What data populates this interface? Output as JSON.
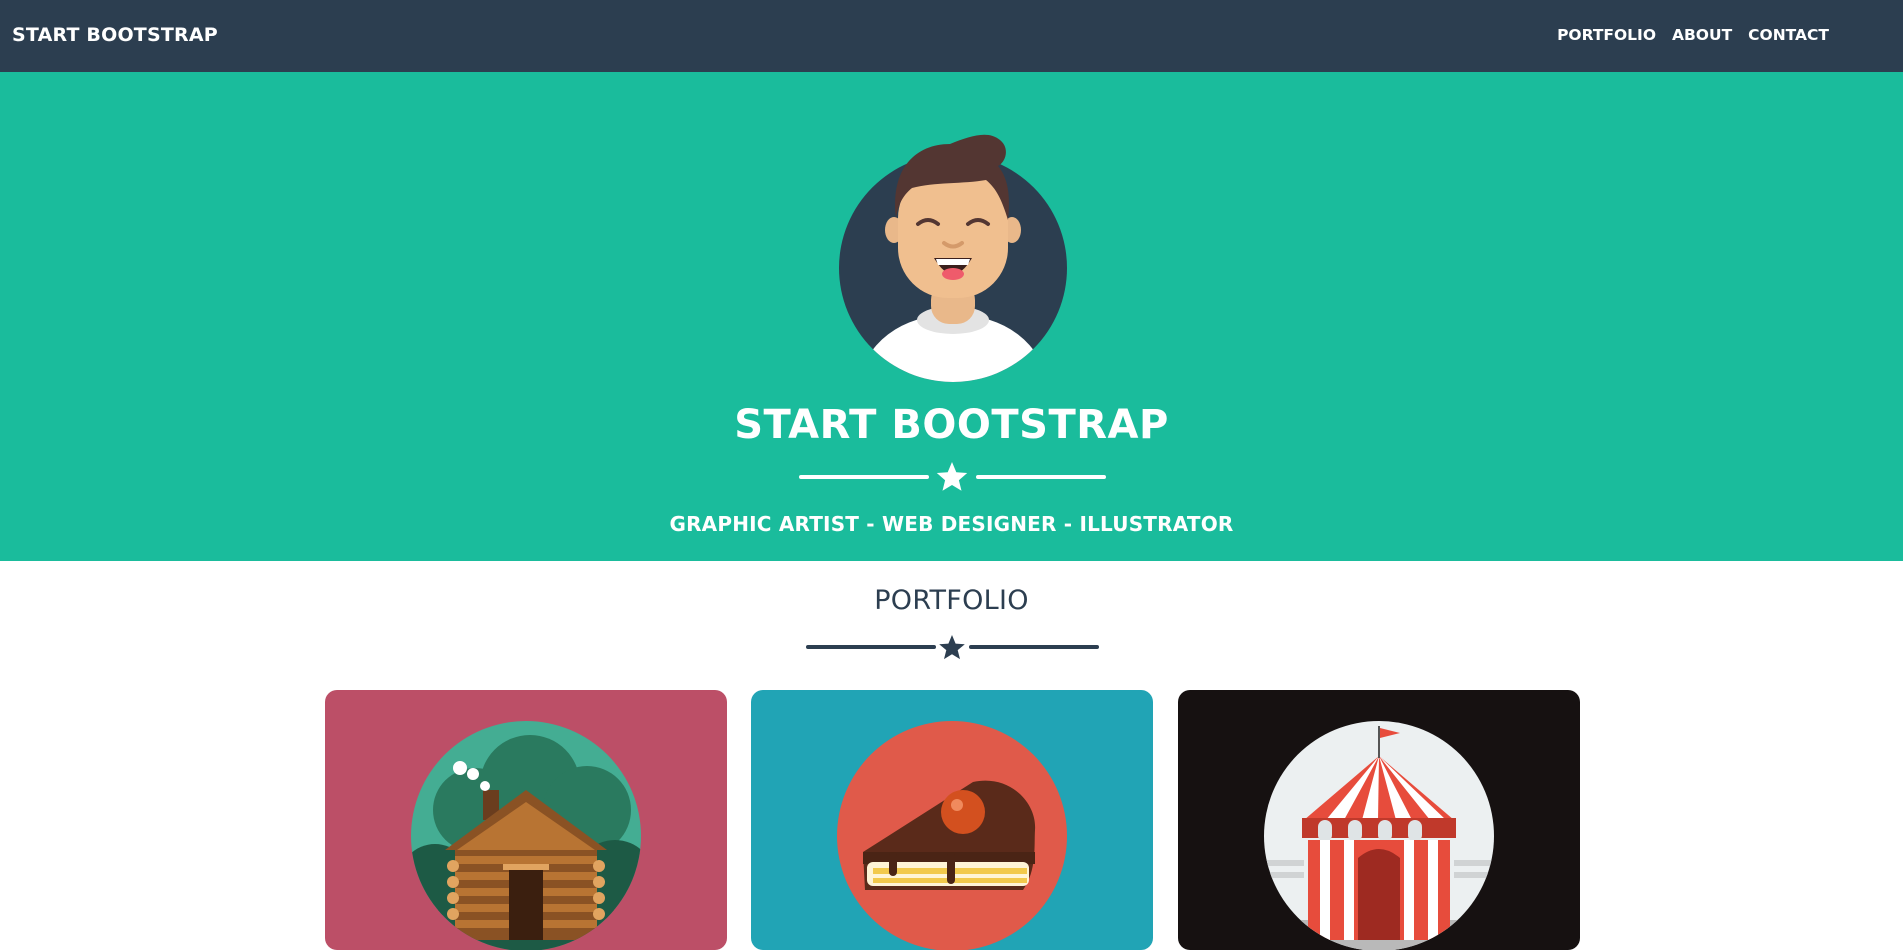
{
  "navbar": {
    "brand": "START BOOTSTRAP",
    "links": [
      "PORTFOLIO",
      "ABOUT",
      "CONTACT"
    ]
  },
  "hero": {
    "title": "START BOOTSTRAP",
    "subtitle": "GRAPHIC ARTIST - WEB DESIGNER - ILLUSTRATOR"
  },
  "portfolio": {
    "title": "PORTFOLIO",
    "items": [
      {
        "image": "cabin"
      },
      {
        "image": "cake"
      },
      {
        "image": "circus-tent"
      }
    ]
  },
  "colors": {
    "navbar": "#2c3e50",
    "hero": "#1abc9c",
    "heading": "#2c3e50",
    "card_cabin": "#bc4f67",
    "card_cake": "#21a4b5",
    "card_circus": "#161111"
  },
  "icons": [
    "star-icon"
  ]
}
